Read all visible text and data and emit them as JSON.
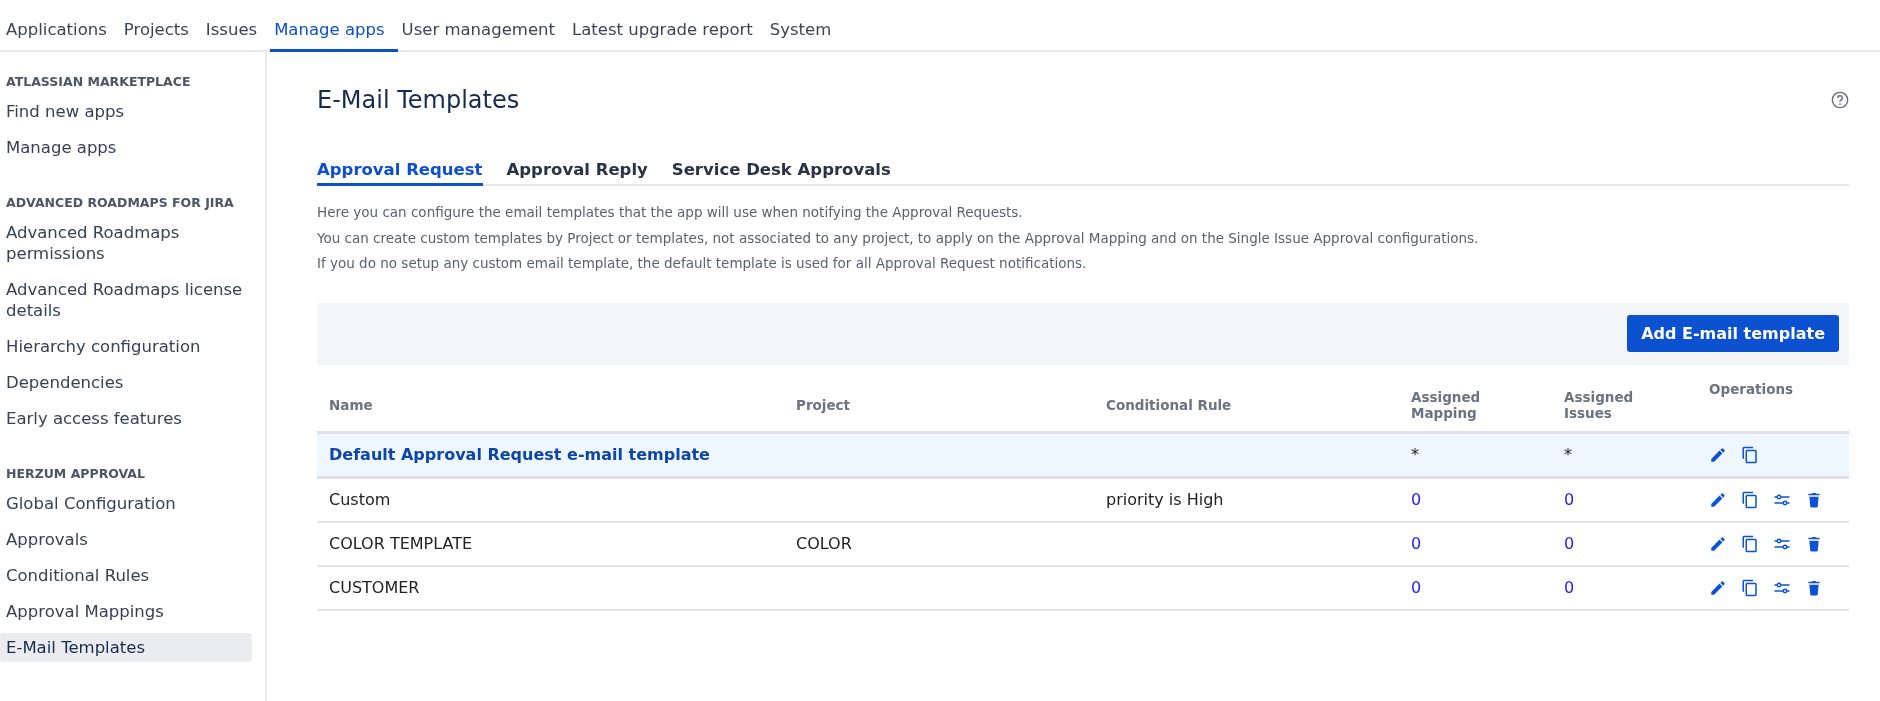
{
  "top_nav": [
    {
      "label": "Applications",
      "selected": false
    },
    {
      "label": "Projects",
      "selected": false
    },
    {
      "label": "Issues",
      "selected": false
    },
    {
      "label": "Manage apps",
      "selected": true
    },
    {
      "label": "User management",
      "selected": false
    },
    {
      "label": "Latest upgrade report",
      "selected": false
    },
    {
      "label": "System",
      "selected": false
    }
  ],
  "sidebar": {
    "sections": [
      {
        "heading": "ATLASSIAN MARKETPLACE",
        "items": [
          {
            "label": "Find new apps",
            "selected": false
          },
          {
            "label": "Manage apps",
            "selected": false
          }
        ]
      },
      {
        "heading": "ADVANCED ROADMAPS FOR JIRA",
        "items": [
          {
            "label": "Advanced Roadmaps permissions",
            "selected": false
          },
          {
            "label": "Advanced Roadmaps license details",
            "selected": false
          },
          {
            "label": "Hierarchy configuration",
            "selected": false
          },
          {
            "label": "Dependencies",
            "selected": false
          },
          {
            "label": "Early access features",
            "selected": false
          }
        ]
      },
      {
        "heading": "HERZUM APPROVAL",
        "items": [
          {
            "label": "Global Configuration",
            "selected": false
          },
          {
            "label": "Approvals",
            "selected": false
          },
          {
            "label": "Conditional Rules",
            "selected": false
          },
          {
            "label": "Approval Mappings",
            "selected": false
          },
          {
            "label": "E-Mail Templates",
            "selected": true
          }
        ]
      }
    ]
  },
  "page": {
    "title": "E-Mail Templates",
    "tabs": [
      {
        "label": "Approval Request",
        "selected": true
      },
      {
        "label": "Approval Reply",
        "selected": false
      },
      {
        "label": "Service Desk Approvals",
        "selected": false
      }
    ],
    "description": [
      "Here you can configure the email templates that the app will use when notifying the Approval Requests.",
      "You can create custom templates by Project or templates, not associated to any project, to apply on the Approval Mapping and on the Single Issue Approval configurations.",
      "If you do no setup any custom email template, the default template is used for all Approval Request notifications."
    ],
    "add_button": "Add E-mail template"
  },
  "table": {
    "columns": [
      "Name",
      "Project",
      "Conditional Rule",
      "Assigned Mapping",
      "Assigned Issues",
      "Operations"
    ],
    "rows": [
      {
        "name": "Default Approval Request e-mail template",
        "project": "",
        "rule": "",
        "mapping": "*",
        "issues": "*",
        "default": true
      },
      {
        "name": "Custom",
        "project": "",
        "rule": "priority is High",
        "mapping": "0",
        "issues": "0",
        "default": false
      },
      {
        "name": "COLOR TEMPLATE",
        "project": "COLOR",
        "rule": "",
        "mapping": "0",
        "issues": "0",
        "default": false
      },
      {
        "name": "CUSTOMER",
        "project": "",
        "rule": "",
        "mapping": "0",
        "issues": "0",
        "default": false
      }
    ]
  }
}
